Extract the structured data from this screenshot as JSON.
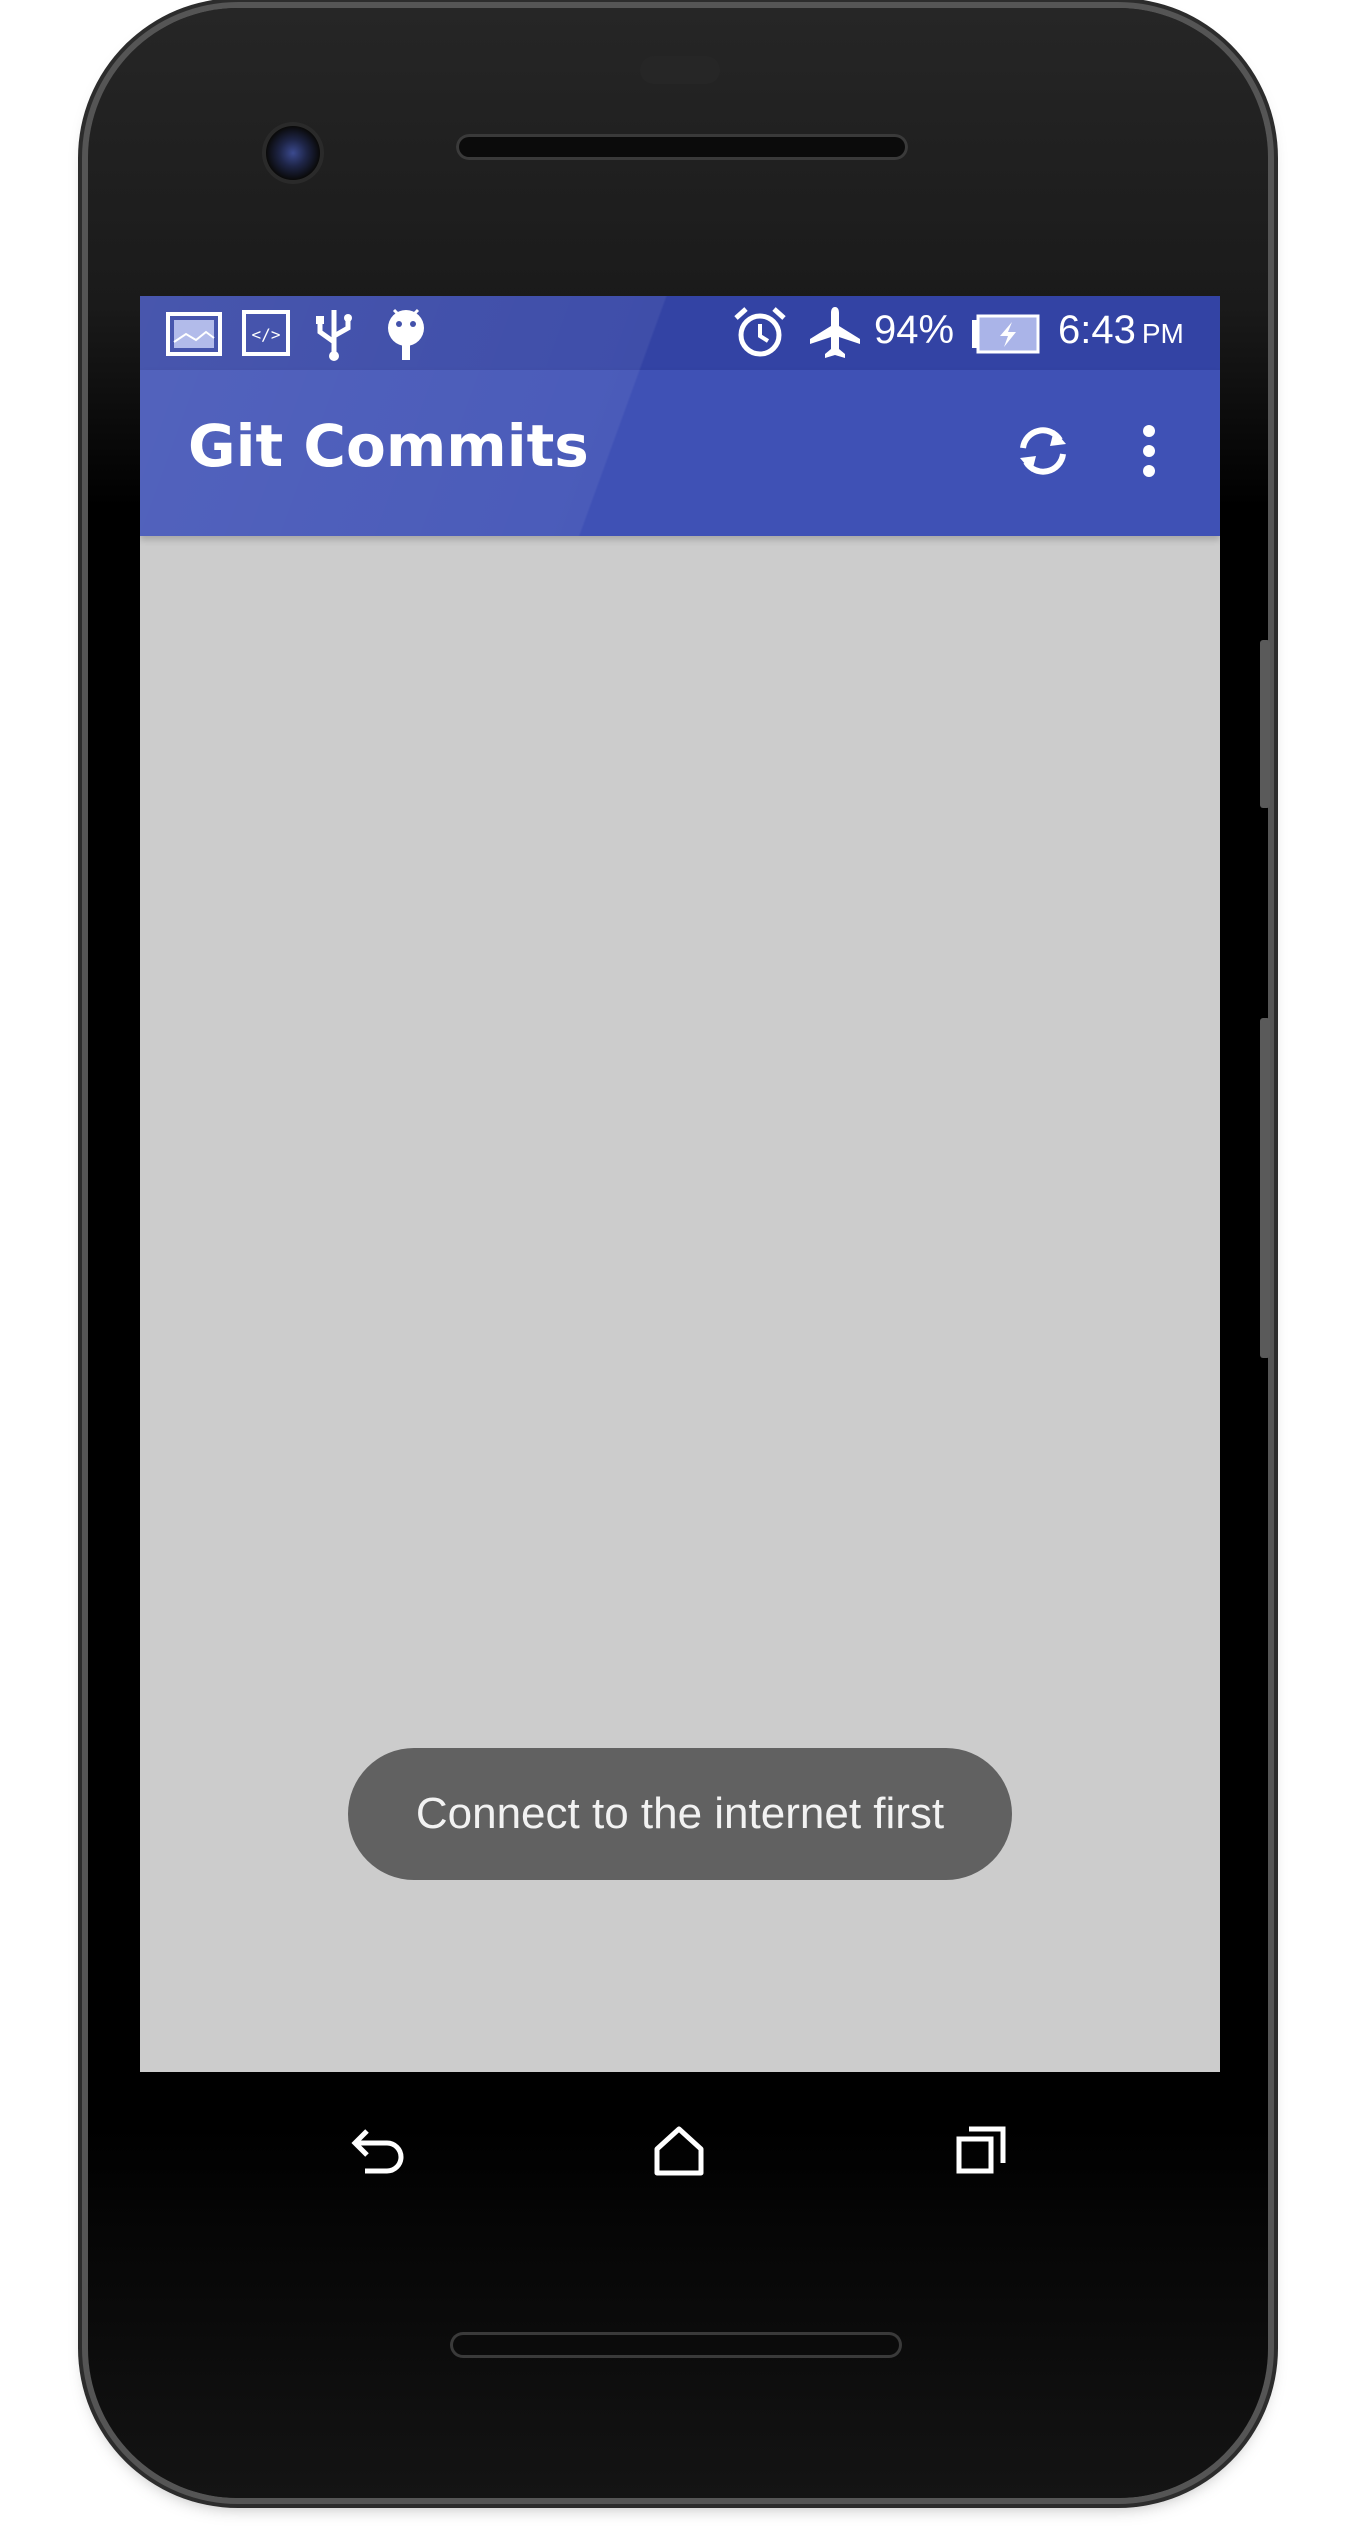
{
  "status_bar": {
    "notification_icons": [
      "gallery-icon",
      "code-icon",
      "usb-icon",
      "android-icon"
    ],
    "system_icons": [
      "alarm-icon",
      "airplane-mode-icon",
      "battery-charging-icon"
    ],
    "battery_percent": "94%",
    "time": "6:43",
    "time_suffix": "PM",
    "background_color": "#3343a4"
  },
  "app_bar": {
    "title": "Git Commits",
    "background_color": "#3f51b5",
    "actions": [
      {
        "icon": "refresh-icon"
      },
      {
        "icon": "overflow-menu-icon"
      }
    ]
  },
  "content": {
    "background_color": "#cccccc"
  },
  "toast": {
    "message": "Connect to the internet first"
  },
  "nav_bar": {
    "buttons": [
      "back-icon",
      "home-icon",
      "recents-icon"
    ]
  }
}
